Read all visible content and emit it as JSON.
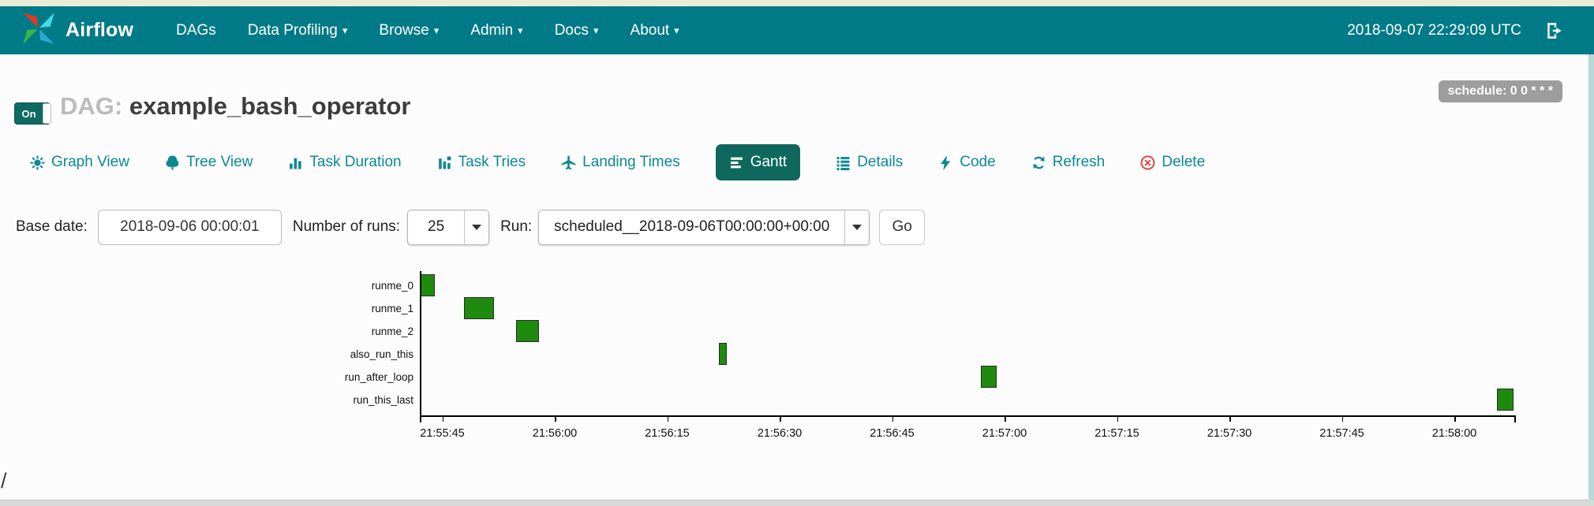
{
  "icons": {
    "caret_down": "▾"
  },
  "colors": {
    "navbar_bg": "#007a87",
    "accent_teal": "#0c8991",
    "active_tab_bg": "#0f685e",
    "bar_green": "#1e8b0e",
    "badge_gray": "#9d9d9d",
    "delete_red": "#d9534f"
  },
  "navbar": {
    "brand": "Airflow",
    "items": [
      {
        "label": "DAGs",
        "caret": false
      },
      {
        "label": "Data Profiling",
        "caret": true
      },
      {
        "label": "Browse",
        "caret": true
      },
      {
        "label": "Admin",
        "caret": true
      },
      {
        "label": "Docs",
        "caret": true
      },
      {
        "label": "About",
        "caret": true
      }
    ],
    "clock": "2018-09-07 22:29:09 UTC"
  },
  "dag_header": {
    "toggle_label": "On",
    "title_prefix": "DAG:",
    "dag_id": "example_bash_operator",
    "schedule_badge": "schedule: 0 0 * * *"
  },
  "tabs": [
    {
      "label": "Graph View",
      "icon": "graph-view-icon",
      "active": false
    },
    {
      "label": "Tree View",
      "icon": "tree-view-icon",
      "active": false
    },
    {
      "label": "Task Duration",
      "icon": "task-duration-icon",
      "active": false
    },
    {
      "label": "Task Tries",
      "icon": "task-tries-icon",
      "active": false
    },
    {
      "label": "Landing Times",
      "icon": "landing-times-icon",
      "active": false
    },
    {
      "label": "Gantt",
      "icon": "gantt-icon",
      "active": true
    },
    {
      "label": "Details",
      "icon": "details-icon",
      "active": false
    },
    {
      "label": "Code",
      "icon": "code-icon",
      "active": false
    },
    {
      "label": "Refresh",
      "icon": "refresh-icon",
      "active": false
    },
    {
      "label": "Delete",
      "icon": "delete-icon",
      "active": false
    }
  ],
  "filter_form": {
    "base_date_label": "Base date:",
    "base_date_value": "2018-09-06 00:00:01",
    "num_runs_label": "Number of runs:",
    "num_runs_value": "25",
    "run_label": "Run:",
    "run_value": "scheduled__2018-09-06T00:00:00+00:00",
    "go_label": "Go"
  },
  "chart_data": {
    "type": "gantt",
    "title": "",
    "tasks": [
      "runme_0",
      "runme_1",
      "runme_2",
      "also_run_this",
      "run_after_loop",
      "run_this_last"
    ],
    "t_domain": [
      0,
      146
    ],
    "t_domain_note": "seconds after 21:55:42",
    "bars": [
      {
        "task": "runme_0",
        "start_s": 0.0,
        "end_s": 2.0
      },
      {
        "task": "runme_1",
        "start_s": 5.9,
        "end_s": 9.9
      },
      {
        "task": "runme_2",
        "start_s": 12.8,
        "end_s": 15.9
      },
      {
        "task": "also_run_this",
        "start_s": 39.9,
        "end_s": 41.0
      },
      {
        "task": "run_after_loop",
        "start_s": 74.8,
        "end_s": 76.9
      },
      {
        "task": "run_this_last",
        "start_s": 143.7,
        "end_s": 145.9
      }
    ],
    "x_ticks": [
      {
        "t": 3,
        "label": "21:55:45"
      },
      {
        "t": 18,
        "label": "21:56:00"
      },
      {
        "t": 33,
        "label": "21:56:15"
      },
      {
        "t": 48,
        "label": "21:56:30"
      },
      {
        "t": 63,
        "label": "21:56:45"
      },
      {
        "t": 78,
        "label": "21:57:00"
      },
      {
        "t": 93,
        "label": "21:57:15"
      },
      {
        "t": 108,
        "label": "21:57:30"
      },
      {
        "t": 123,
        "label": "21:57:45"
      },
      {
        "t": 138,
        "label": "21:58:00"
      }
    ],
    "bar_color": "#1e8b0e"
  },
  "footer": {
    "path_text": "/"
  }
}
